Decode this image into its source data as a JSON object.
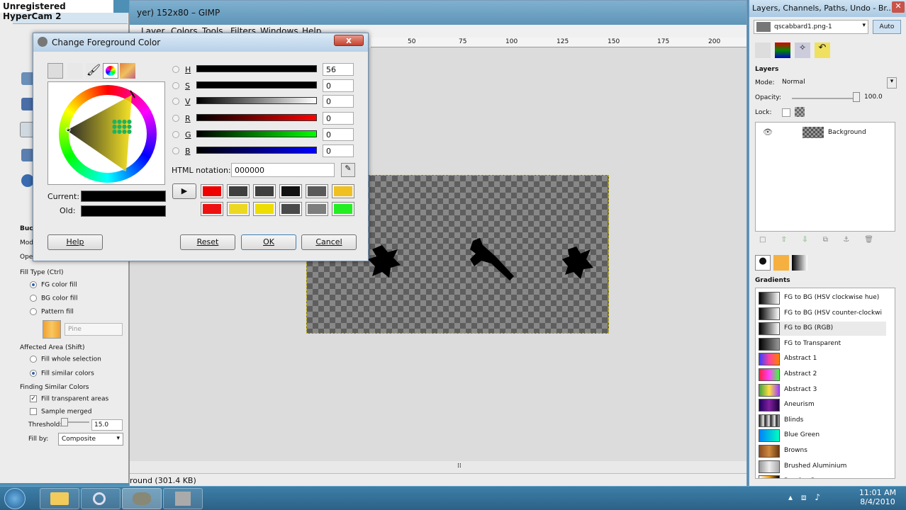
{
  "hypercam": "Unregistered HyperCam 2",
  "gimp": {
    "title": "yer) 152x80 – GIMP",
    "menu": [
      "Layer",
      "Colors",
      "Tools",
      "Filters",
      "Windows",
      "Help"
    ],
    "ruler_ticks": [
      "50",
      "75",
      "100",
      "125",
      "150",
      "175",
      "200"
    ],
    "status": "round (301.4 KB)"
  },
  "toolbox": {
    "bucket_label": "Buck",
    "mode_label": "Mod",
    "opacity_label": "Ope",
    "fill_type_label": "Fill Type  (Ctrl)",
    "fill_options": [
      "FG color fill",
      "BG color fill",
      "Pattern fill"
    ],
    "pattern_name": "Pine",
    "affected_area_label": "Affected Area  (Shift)",
    "area_options": [
      "Fill whole selection",
      "Fill similar colors"
    ],
    "finding_label": "Finding Similar Colors",
    "fill_transparent": "Fill transparent areas",
    "sample_merged": "Sample merged",
    "threshold_label": "Threshold:",
    "threshold_value": "15.0",
    "fill_by_label": "Fill by:",
    "fill_by_value": "Composite"
  },
  "color_dialog": {
    "title": "Change Foreground Color",
    "close_label": "x",
    "channels": [
      {
        "label": "H",
        "value": "56",
        "gradient": "linear-gradient(90deg,#000,#000)"
      },
      {
        "label": "S",
        "value": "0",
        "gradient": "linear-gradient(90deg,#000,#000)"
      },
      {
        "label": "V",
        "value": "0",
        "gradient": "linear-gradient(90deg,#000,#fff)"
      },
      {
        "label": "R",
        "value": "0",
        "gradient": "linear-gradient(90deg,#000,#f00)"
      },
      {
        "label": "G",
        "value": "0",
        "gradient": "linear-gradient(90deg,#000,#0f0)"
      },
      {
        "label": "B",
        "value": "0",
        "gradient": "linear-gradient(90deg,#000,#00f)"
      }
    ],
    "html_label": "HTML notation:",
    "html_value": "000000",
    "current_label": "Current:",
    "old_label": "Old:",
    "history_row1": [
      "#ee0000",
      "#3f3f3f",
      "#3f3f3f",
      "#111111",
      "#5a5a5a",
      "#f0c020"
    ],
    "history_row2": [
      "#ee1111",
      "#ecd820",
      "#eedd00",
      "#4a4a4a",
      "#7d7d7d",
      "#22ee22"
    ],
    "help_label": "Help",
    "reset_label": "Reset",
    "ok_label": "OK",
    "cancel_label": "Cancel"
  },
  "dock": {
    "title": "Layers, Channels, Paths, Undo - Br...",
    "image_name": "qscabbard1.png-1",
    "auto_label": "Auto",
    "layers_label": "Layers",
    "mode_label": "Mode:",
    "mode_value": "Normal",
    "opacity_label": "Opacity:",
    "opacity_value": "100.0",
    "lock_label": "Lock:",
    "layer_name": "Background",
    "gradients_label": "Gradients",
    "gradients": [
      {
        "name": "FG to BG (HSV clockwise hue)",
        "css": "linear-gradient(90deg,#000,#fff)"
      },
      {
        "name": "FG to BG (HSV counter-clockwi",
        "css": "linear-gradient(90deg,#000,#fff)"
      },
      {
        "name": "FG to BG (RGB)",
        "css": "linear-gradient(90deg,#000,#fff)"
      },
      {
        "name": "FG to Transparent",
        "css": "linear-gradient(90deg,#000,#999)"
      },
      {
        "name": "Abstract 1",
        "css": "linear-gradient(90deg,#3040ff,#ff40a0,#ff8000)"
      },
      {
        "name": "Abstract 2",
        "css": "linear-gradient(90deg,#ff2040,#ff40ff,#40ff40)"
      },
      {
        "name": "Abstract 3",
        "css": "linear-gradient(90deg,#40a040,#ffe040,#a040ff)"
      },
      {
        "name": "Aneurism",
        "css": "linear-gradient(90deg,#200060,#8020a0,#200040)"
      },
      {
        "name": "Blinds",
        "css": "repeating-linear-gradient(90deg,#222 0,#eee 6px,#222 8px)"
      },
      {
        "name": "Blue Green",
        "css": "linear-gradient(90deg,#0080ff,#00ffc0)"
      },
      {
        "name": "Browns",
        "css": "linear-gradient(90deg,#8a4a20,#d08a40,#6a3a10)"
      },
      {
        "name": "Brushed Aluminium",
        "css": "linear-gradient(90deg,#999,#eee,#aaa)"
      },
      {
        "name": "Burning Paper",
        "css": "linear-gradient(90deg,#fff,#ffa000,#000)"
      }
    ]
  },
  "taskbar": {
    "time": "11:01 AM",
    "date": "8/4/2010"
  }
}
